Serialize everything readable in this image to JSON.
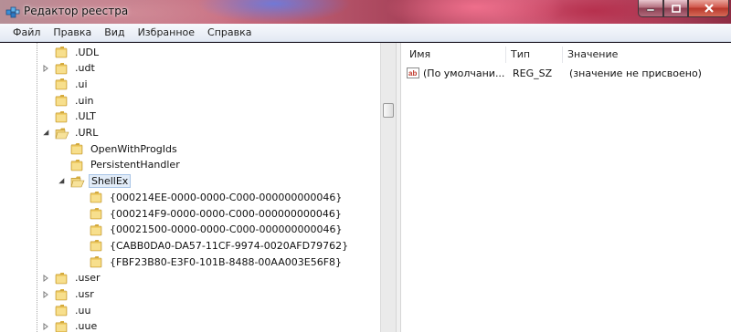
{
  "window": {
    "title": "Редактор реестра",
    "app_icon": "regedit-icon"
  },
  "menu": [
    "Файл",
    "Правка",
    "Вид",
    "Избранное",
    "Справка"
  ],
  "tree": [
    {
      "label": ".UDL",
      "level": 1,
      "expander": "none",
      "state": "closed"
    },
    {
      "label": ".udt",
      "level": 1,
      "expander": "collapsed",
      "state": "closed"
    },
    {
      "label": ".ui",
      "level": 1,
      "expander": "none",
      "state": "closed"
    },
    {
      "label": ".uin",
      "level": 1,
      "expander": "none",
      "state": "closed"
    },
    {
      "label": ".ULT",
      "level": 1,
      "expander": "none",
      "state": "closed"
    },
    {
      "label": ".URL",
      "level": 1,
      "expander": "expanded",
      "state": "open"
    },
    {
      "label": "OpenWithProgIds",
      "level": 2,
      "expander": "none",
      "state": "closed"
    },
    {
      "label": "PersistentHandler",
      "level": 2,
      "expander": "none",
      "state": "closed"
    },
    {
      "label": "ShellEx",
      "level": 2,
      "expander": "expanded",
      "state": "open",
      "selected": true
    },
    {
      "label": "{000214EE-0000-0000-C000-000000000046}",
      "level": 3,
      "expander": "none",
      "state": "closed"
    },
    {
      "label": "{000214F9-0000-0000-C000-000000000046}",
      "level": 3,
      "expander": "none",
      "state": "closed"
    },
    {
      "label": "{00021500-0000-0000-C000-000000000046}",
      "level": 3,
      "expander": "none",
      "state": "closed"
    },
    {
      "label": "{CABB0DA0-DA57-11CF-9974-0020AFD79762}",
      "level": 3,
      "expander": "none",
      "state": "closed"
    },
    {
      "label": "{FBF23B80-E3F0-101B-8488-00AA003E56F8}",
      "level": 3,
      "expander": "none",
      "state": "closed"
    },
    {
      "label": ".user",
      "level": 1,
      "expander": "collapsed",
      "state": "closed"
    },
    {
      "label": ".usr",
      "level": 1,
      "expander": "collapsed",
      "state": "closed"
    },
    {
      "label": ".uu",
      "level": 1,
      "expander": "none",
      "state": "closed"
    },
    {
      "label": ".uue",
      "level": 1,
      "expander": "collapsed",
      "state": "closed"
    }
  ],
  "values_list": {
    "columns": [
      "Имя",
      "Тип",
      "Значение"
    ],
    "rows": [
      {
        "icon": "string-value-ab-icon",
        "name": "(По умолчани...",
        "type": "REG_SZ",
        "data": "(значение не присвоено)"
      }
    ]
  },
  "colors": {
    "folder": "#e8c25a",
    "selection": "#e2ecf8",
    "close_button": "#c8453a"
  }
}
